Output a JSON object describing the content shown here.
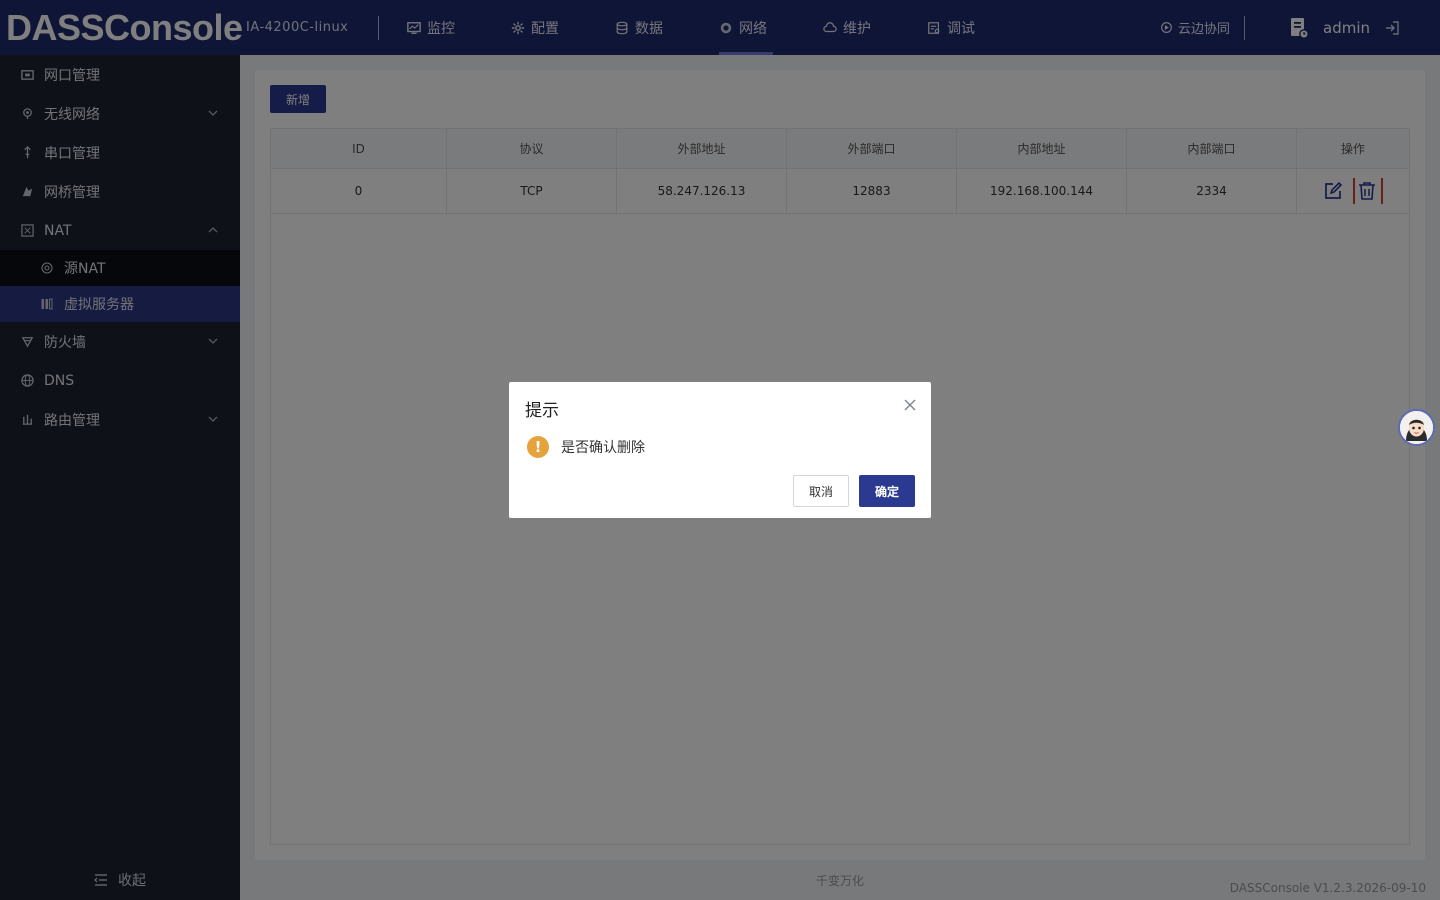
{
  "header": {
    "brand": "DASSConsole",
    "device": "IA-4200C-linux",
    "nav": [
      {
        "label": "监控",
        "icon": "monitor-icon"
      },
      {
        "label": "配置",
        "icon": "config-icon"
      },
      {
        "label": "数据",
        "icon": "database-icon"
      },
      {
        "label": "网络",
        "icon": "network-icon",
        "active": true
      },
      {
        "label": "维护",
        "icon": "maintenance-icon"
      },
      {
        "label": "调试",
        "icon": "debug-icon"
      }
    ],
    "cloud_label": "云边协同",
    "user": "admin"
  },
  "sidebar": {
    "items": [
      {
        "label": "网口管理"
      },
      {
        "label": "无线网络"
      },
      {
        "label": "串口管理"
      },
      {
        "label": "网桥管理"
      },
      {
        "label": "NAT"
      },
      {
        "label": "防火墙"
      },
      {
        "label": "DNS"
      },
      {
        "label": "路由管理"
      }
    ],
    "nat_sub": [
      {
        "label": "源NAT"
      },
      {
        "label": "虚拟服务器"
      }
    ],
    "collapse_label": "收起"
  },
  "toolbar": {
    "add_label": "新增"
  },
  "table": {
    "columns": [
      "ID",
      "协议",
      "外部地址",
      "外部端口",
      "内部地址",
      "内部端口",
      "操作"
    ],
    "rows": [
      [
        "0",
        "TCP",
        "58.247.126.13",
        "12883",
        "192.168.100.144",
        "2334"
      ]
    ]
  },
  "footer": {
    "center": "千变万化",
    "version": "DASSConsole V1.2.3.2026-09-10"
  },
  "dialog": {
    "title": "提示",
    "message": "是否确认删除",
    "cancel_label": "取消",
    "ok_label": "确定"
  },
  "colors": {
    "header_bg": "#1f2a6e",
    "sidebar_bg": "#1f2233",
    "primary": "#2b3990",
    "warning": "#e6a23c",
    "danger": "#d23a3a"
  }
}
